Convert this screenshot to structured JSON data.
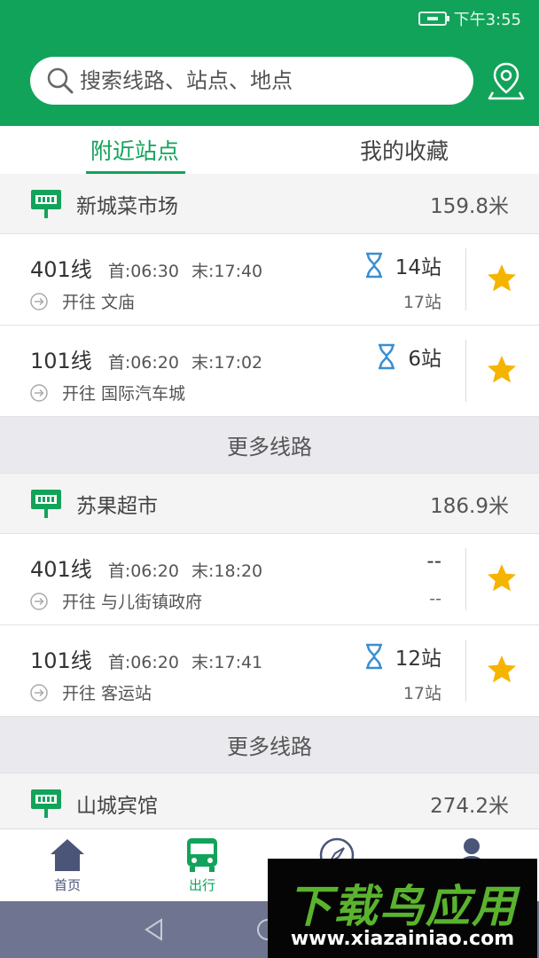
{
  "status": {
    "time": "下午3:55"
  },
  "search": {
    "placeholder": "搜索线路、站点、地点"
  },
  "tabs": [
    {
      "label": "附近站点",
      "active": true
    },
    {
      "label": "我的收藏",
      "active": false
    }
  ],
  "stops": [
    {
      "name": "新城菜市场",
      "distance": "159.8米",
      "routes": [
        {
          "name": "401线",
          "first": "首:06:30",
          "last": "末:17:40",
          "arrival": "14站",
          "show_hourglass": true,
          "direction": "开往 文庙",
          "total": "17站"
        },
        {
          "name": "101线",
          "first": "首:06:20",
          "last": "末:17:02",
          "arrival": "6站",
          "show_hourglass": true,
          "direction": "开往 国际汽车城",
          "total": ""
        }
      ],
      "more_label": "更多线路"
    },
    {
      "name": "苏果超市",
      "distance": "186.9米",
      "routes": [
        {
          "name": "401线",
          "first": "首:06:20",
          "last": "末:18:20",
          "arrival": "--",
          "show_hourglass": false,
          "direction": "开往 与儿街镇政府",
          "total": "--"
        },
        {
          "name": "101线",
          "first": "首:06:20",
          "last": "末:17:41",
          "arrival": "12站",
          "show_hourglass": true,
          "direction": "开往 客运站",
          "total": "17站"
        }
      ],
      "more_label": "更多线路"
    },
    {
      "name": "山城宾馆",
      "distance": "274.2米",
      "routes": []
    }
  ],
  "tabbar": [
    {
      "label": "首页",
      "icon": "home-icon",
      "active": false
    },
    {
      "label": "出行",
      "icon": "bus-icon",
      "active": true
    },
    {
      "label": "",
      "icon": "compass-icon",
      "active": false
    },
    {
      "label": "",
      "icon": "user-icon",
      "active": false
    }
  ],
  "watermark": {
    "title": "下载鸟应用",
    "url": "www.xiazainiao.com"
  },
  "colors": {
    "primary": "#12a35a",
    "star": "#f5b400",
    "hourglass": "#3a8fd0",
    "navbar": "#6f7590"
  }
}
